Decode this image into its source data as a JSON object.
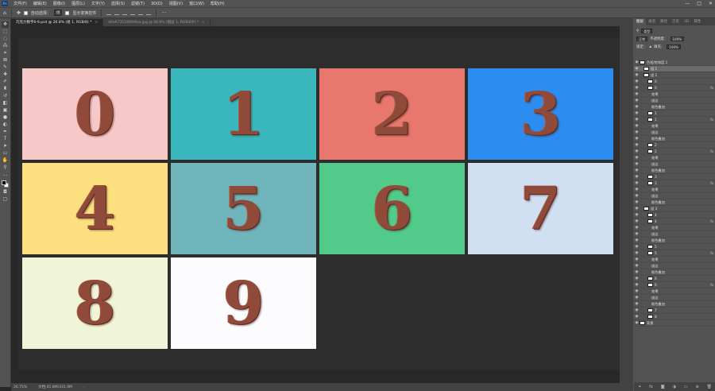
{
  "menubar": {
    "logo": "Ps",
    "items": [
      "文件(F)",
      "编辑(E)",
      "图像(I)",
      "图层(L)",
      "文字(Y)",
      "选择(S)",
      "滤镜(T)",
      "3D(D)",
      "视图(V)",
      "窗口(W)",
      "帮助(H)"
    ],
    "window_controls": [
      "—",
      "□",
      "✕"
    ]
  },
  "options": {
    "auto_select_label": "自动选择：",
    "auto_select_value": "组",
    "transform_label": "显示变换控件"
  },
  "tabs": [
    {
      "label": "巧克力数字0-9.psd @ 26.8% (组 1, RGB/8) *",
      "active": true
    },
    {
      "label": "46e6735186fe9ea.jpg @ 48.8% (图层 1, RGB/8#) *",
      "active": false
    }
  ],
  "tiles": [
    {
      "digit": "0",
      "color": "#f6c8c8"
    },
    {
      "digit": "1",
      "color": "#3ab7bd"
    },
    {
      "digit": "2",
      "color": "#e8786e"
    },
    {
      "digit": "3",
      "color": "#2d8cef"
    },
    {
      "digit": "4",
      "color": "#fcdf7e"
    },
    {
      "digit": "5",
      "color": "#6fb5bb"
    },
    {
      "digit": "6",
      "color": "#51ca8a"
    },
    {
      "digit": "7",
      "color": "#d0dff2"
    },
    {
      "digit": "8",
      "color": "#f1f5d7"
    },
    {
      "digit": "9",
      "color": "#fcfcff"
    }
  ],
  "status": {
    "zoom": "26.75%",
    "doc": "文档:41.8M/331.9M"
  },
  "panel": {
    "tabs": [
      "图层",
      "通道",
      "路径",
      "历史",
      "3D",
      "属性"
    ],
    "kind_label": "类型",
    "blend_mode": "正常",
    "opacity_label": "不透明度：",
    "opacity": "100%",
    "lock_label": "锁定：",
    "fill_label": "填充：",
    "fill": "100%",
    "layers": [
      {
        "name": "色相/饱和度 1",
        "fx": "",
        "selected": false
      },
      {
        "name": "组 1",
        "fx": "",
        "selected": true
      },
      {
        "name": "组 2",
        "fx": "",
        "selected": false
      },
      {
        "name": "0",
        "fx": "",
        "selected": false
      },
      {
        "name": "0",
        "fx": "fx",
        "selected": false
      },
      {
        "name": "效果",
        "fx": "",
        "selected": false
      },
      {
        "name": "描边",
        "fx": "",
        "selected": false
      },
      {
        "name": "颜色叠加",
        "fx": "",
        "selected": false
      },
      {
        "name": "1",
        "fx": "",
        "selected": false
      },
      {
        "name": "1",
        "fx": "fx",
        "selected": false
      },
      {
        "name": "效果",
        "fx": "",
        "selected": false
      },
      {
        "name": "描边",
        "fx": "",
        "selected": false
      },
      {
        "name": "颜色叠加",
        "fx": "",
        "selected": false
      },
      {
        "name": "2",
        "fx": "",
        "selected": false
      },
      {
        "name": "2",
        "fx": "fx",
        "selected": false
      },
      {
        "name": "效果",
        "fx": "",
        "selected": false
      },
      {
        "name": "描边",
        "fx": "",
        "selected": false
      },
      {
        "name": "颜色叠加",
        "fx": "",
        "selected": false
      },
      {
        "name": "3",
        "fx": "",
        "selected": false
      },
      {
        "name": "3",
        "fx": "fx",
        "selected": false
      },
      {
        "name": "效果",
        "fx": "",
        "selected": false
      },
      {
        "name": "描边",
        "fx": "",
        "selected": false
      },
      {
        "name": "颜色叠加",
        "fx": "",
        "selected": false
      },
      {
        "name": "组 3",
        "fx": "",
        "selected": false
      },
      {
        "name": "4",
        "fx": "",
        "selected": false
      },
      {
        "name": "4",
        "fx": "fx",
        "selected": false
      },
      {
        "name": "效果",
        "fx": "",
        "selected": false
      },
      {
        "name": "描边",
        "fx": "",
        "selected": false
      },
      {
        "name": "颜色叠加",
        "fx": "",
        "selected": false
      },
      {
        "name": "5",
        "fx": "",
        "selected": false
      },
      {
        "name": "5",
        "fx": "fx",
        "selected": false
      },
      {
        "name": "效果",
        "fx": "",
        "selected": false
      },
      {
        "name": "描边",
        "fx": "",
        "selected": false
      },
      {
        "name": "颜色叠加",
        "fx": "",
        "selected": false
      },
      {
        "name": "6",
        "fx": "",
        "selected": false
      },
      {
        "name": "6",
        "fx": "fx",
        "selected": false
      },
      {
        "name": "效果",
        "fx": "",
        "selected": false
      },
      {
        "name": "描边",
        "fx": "",
        "selected": false
      },
      {
        "name": "颜色叠加",
        "fx": "",
        "selected": false
      },
      {
        "name": "7",
        "fx": "",
        "selected": false
      },
      {
        "name": "8",
        "fx": "",
        "selected": false
      },
      {
        "name": "背景",
        "fx": "",
        "selected": false
      }
    ]
  },
  "icons": {
    "tools": [
      "move-icon",
      "marquee-icon",
      "lasso-icon",
      "magic-wand-icon",
      "crop-icon",
      "frame-icon",
      "eyedropper-icon",
      "healing-icon",
      "brush-icon",
      "stamp-icon",
      "history-brush-icon",
      "eraser-icon",
      "gradient-icon",
      "blur-icon",
      "dodge-icon",
      "pen-icon",
      "type-icon",
      "path-select-icon",
      "shape-icon",
      "hand-icon",
      "zoom-icon"
    ]
  }
}
